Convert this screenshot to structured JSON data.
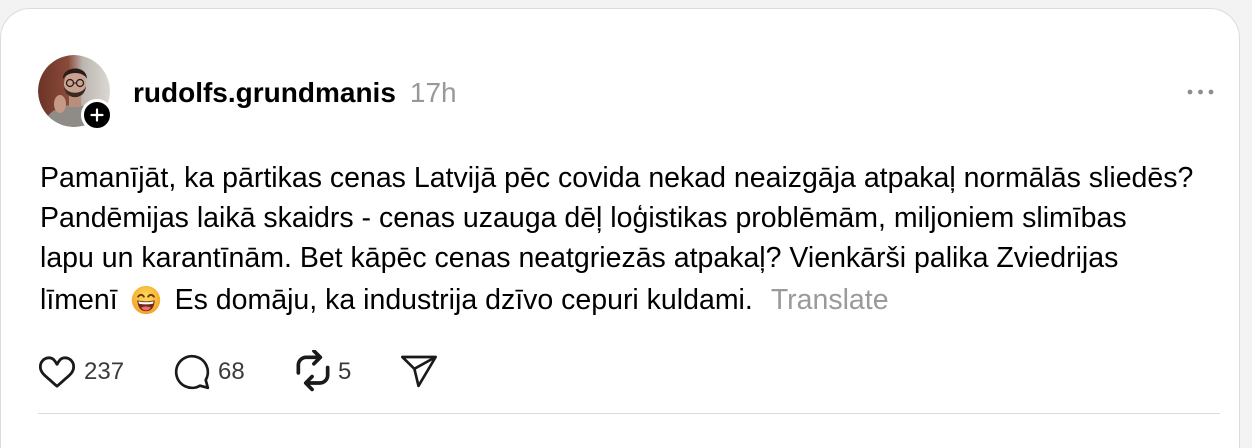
{
  "post": {
    "author": {
      "username": "rudolfs.grundmanis",
      "timestamp": "17h"
    },
    "body_lines": [
      "Pamanījāt, ka pārtikas cenas Latvijā pēc covida nekad neaizgāja atpakaļ normālās sliedēs?",
      "Pandēmijas laikā skaidrs - cenas uzauga dēļ loģistikas problēmām, miljoniem slimības",
      "lapu un karantīnām. Bet kāpēc cenas neatgriezās atpakaļ? Vienkārši palika Zviedrijas"
    ],
    "last_line": {
      "before_emoji": "līmenī",
      "emoji": "grinning-face-with-smiling-eyes",
      "after_emoji": "Es domāju, ka industrija dzīvo cepuri kuldami.",
      "translate_label": "Translate"
    },
    "actions": {
      "likes": "237",
      "replies": "68",
      "reposts": "5"
    }
  },
  "icons": {
    "avatar": "user-photo",
    "follow": "plus-icon",
    "more": "more-icon",
    "like": "heart-icon",
    "reply": "comment-icon",
    "repost": "repost-icon",
    "share": "send-icon"
  },
  "colors": {
    "text": "#000000",
    "muted": "#999999",
    "counts": "#3b3b3b",
    "divider": "#dbdbdb",
    "card_border": "#dcdcdc",
    "page_background": "#f3f3f3"
  }
}
